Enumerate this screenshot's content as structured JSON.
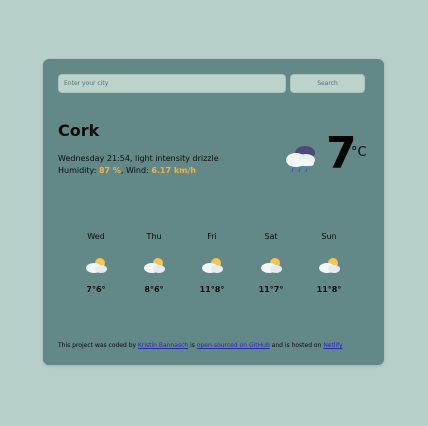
{
  "search": {
    "placeholder": "Enter your city",
    "button_label": "Search"
  },
  "current": {
    "city": "Cork",
    "datetime_desc": "Wednesday 21:54, light intensity drizzle",
    "humidity_label": "Humidity: ",
    "humidity_value": "87 %",
    "wind_label": ", Wind: ",
    "wind_value": "6.17 km/h",
    "temperature": "7",
    "unit": "°C",
    "icon": "rain-cloud-icon"
  },
  "forecast": [
    {
      "day": "Wed",
      "temp": "7°6°",
      "icon": "partly-cloudy-icon"
    },
    {
      "day": "Thu",
      "temp": "8°6°",
      "icon": "partly-cloudy-icon"
    },
    {
      "day": "Fri",
      "temp": "11°8°",
      "icon": "partly-cloudy-icon"
    },
    {
      "day": "Sat",
      "temp": "11°7°",
      "icon": "partly-cloudy-icon"
    },
    {
      "day": "Sun",
      "temp": "11°8°",
      "icon": "partly-cloudy-icon"
    }
  ],
  "footer": {
    "text1": "This project was coded by ",
    "author_link": "Kristin Bannasch",
    "text2": " is ",
    "github_link": "open-sourced on GitHub",
    "text3": " and is hosted on ",
    "netlify_link": "Netlify"
  },
  "colors": {
    "background": "#b6d0c9",
    "card": "#628888",
    "highlight": "#f2b24a",
    "link": "#2d2ab0"
  }
}
